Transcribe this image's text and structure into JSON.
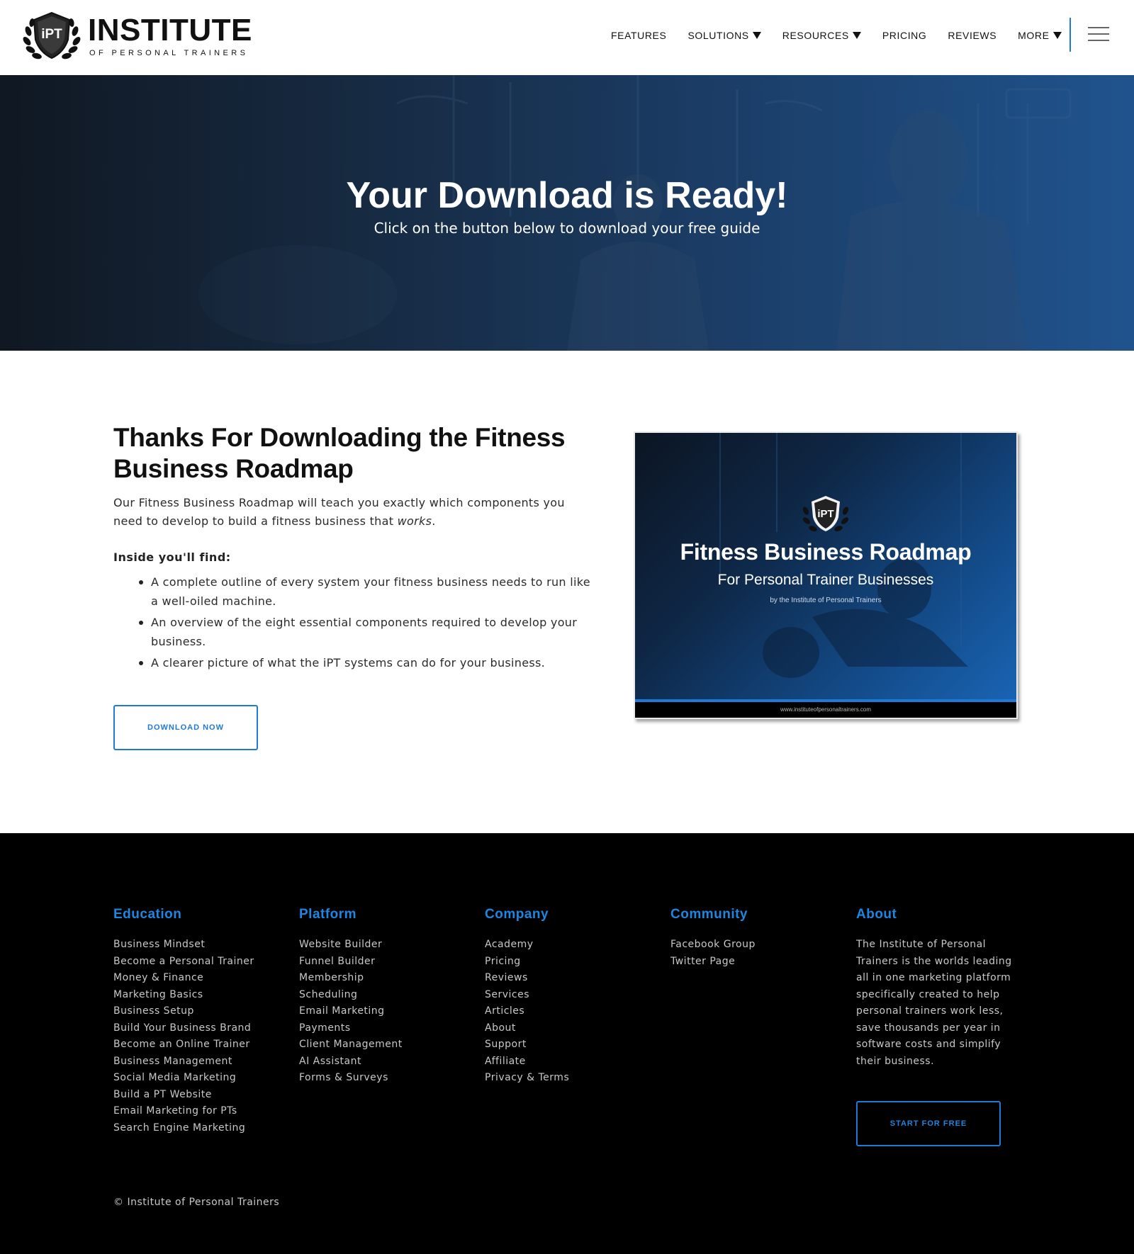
{
  "header": {
    "logo_badge": "iPT",
    "logo_title": "INSTITUTE",
    "logo_subtitle": "OF PERSONAL TRAINERS",
    "nav": [
      {
        "label": "FEATURES",
        "dropdown": false
      },
      {
        "label": "SOLUTIONS",
        "dropdown": true
      },
      {
        "label": "RESOURCES",
        "dropdown": true
      },
      {
        "label": "PRICING",
        "dropdown": false
      },
      {
        "label": "REVIEWS",
        "dropdown": false
      },
      {
        "label": "MORE",
        "dropdown": true
      }
    ],
    "menu_icon": "hamburger-icon"
  },
  "hero": {
    "title": "Your Download is Ready!",
    "subtitle": "Click on the button below to download your free guide"
  },
  "content": {
    "title": "Thanks For Downloading the Fitness Business Roadmap",
    "intro_main": "Our Fitness Business Roadmap will teach you exactly which components you need to develop to build a fitness business that ",
    "intro_em": "works",
    "intro_end": ".",
    "inside_label": "Inside you'll find:",
    "bullets": [
      "A complete outline of every system your fitness business needs to run like a well-oiled machine.",
      "An overview of the eight essential components required to develop your business.",
      "A clearer picture of what the iPT systems can do for your business."
    ],
    "download_button": "DOWNLOAD NOW"
  },
  "cover": {
    "badge": "iPT",
    "title": "Fitness Business Roadmap",
    "subtitle": "For Personal Trainer Businesses",
    "byline": "by the Institute of Personal Trainers",
    "url": "www.instituteofpersonaltrainers.com"
  },
  "footer": {
    "education": {
      "heading": "Education",
      "links": [
        "Business Mindset",
        "Become a Personal Trainer",
        "Money & Finance",
        "Marketing Basics",
        "Business Setup",
        "Build Your Business Brand",
        "Become an Online Trainer",
        "Business Management",
        "Social Media Marketing",
        "Build a PT Website",
        "Email Marketing for PTs",
        "Search Engine Marketing"
      ]
    },
    "platform": {
      "heading": "Platform",
      "links": [
        "Website Builder",
        "Funnel Builder",
        "Membership",
        "Scheduling",
        "Email Marketing",
        "Payments",
        "Client Management",
        "AI Assistant",
        "Forms & Surveys"
      ]
    },
    "company": {
      "heading": "Company",
      "links": [
        "Academy",
        "Pricing",
        "Reviews",
        "Services",
        "Articles",
        "About",
        "Support",
        "Affiliate",
        "Privacy & Terms"
      ]
    },
    "community": {
      "heading": "Community",
      "links": [
        "Facebook Group",
        "Twitter Page"
      ]
    },
    "about": {
      "heading": "About",
      "text": "The Institute of Personal Trainers is the worlds leading all in one marketing platform specifically created to help personal trainers work less, save thousands per year in software costs and simplify their business."
    },
    "start_button": "START FOR FREE",
    "copyright": "© Institute of Personal Trainers"
  },
  "colors": {
    "accent": "#1e7ad6",
    "footer_bg": "#000000",
    "hero_overlay": "#1b3b62"
  }
}
